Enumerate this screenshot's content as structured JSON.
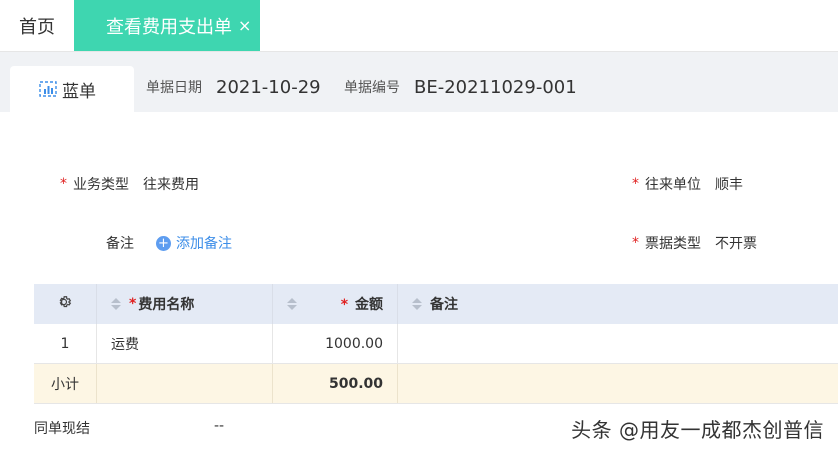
{
  "tabs": {
    "home": "首页",
    "active": "查看费用支出单",
    "close": "×"
  },
  "doc_tab": {
    "label": "蓝单"
  },
  "meta": {
    "date_label": "单据日期",
    "date_value": "2021-10-29",
    "no_label": "单据编号",
    "no_value": "BE-20211029-001"
  },
  "form": {
    "biz_type_label": "业务类型",
    "biz_type_value": "往来费用",
    "partner_label": "往来单位",
    "partner_value": "顺丰",
    "note_label": "备注",
    "add_note": "添加备注",
    "invoice_label": "票据类型",
    "invoice_value": "不开票",
    "required_mark": "*"
  },
  "table": {
    "headers": {
      "name": "费用名称",
      "amount": "金额",
      "note": "备注"
    },
    "rows": [
      {
        "index": "1",
        "name": "运费",
        "amount": "1000.00",
        "note": ""
      }
    ],
    "subtotal": {
      "label": "小计",
      "amount": "500.00"
    }
  },
  "footer": {
    "label": "同单现结",
    "value": "--"
  },
  "watermark": "头条 @用友一成都杰创普信",
  "colors": {
    "accent": "#3ed6b0",
    "link": "#3d8ee8",
    "required": "#e02020",
    "subtotal_bg": "#fdf6e4",
    "header_bg": "#e4eaf5"
  }
}
